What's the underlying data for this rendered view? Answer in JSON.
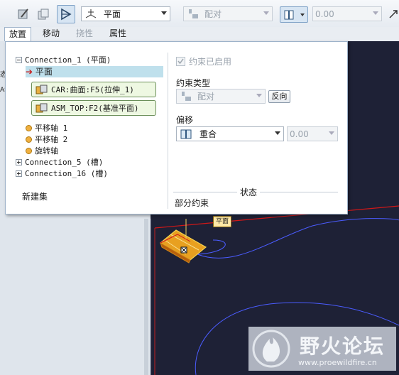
{
  "toolbar": {
    "constraint_type": "平面",
    "align_type": "配对",
    "offset_value": "0.00"
  },
  "tabs": [
    {
      "label": "放置"
    },
    {
      "label": "移动"
    },
    {
      "label": "挠性"
    },
    {
      "label": "属性"
    }
  ],
  "left_fragments": [
    "态",
    "ASM"
  ],
  "tree": {
    "root": "Connection_1 (平面)",
    "selected": "平面",
    "refs": [
      "CAR:曲面:F5(拉伸_1)",
      "ASM_TOP:F2(基准平面)"
    ],
    "items": [
      "平移轴 1",
      "平移轴 2",
      "旋转轴"
    ],
    "collapsed": [
      "Connection_5 (槽)",
      "Connection_16 (槽)"
    ],
    "new_set": "新建集"
  },
  "options": {
    "constraint_enabled": "约束已启用",
    "constraint_type_label": "约束类型",
    "constraint_type_value": "配对",
    "flip_button": "反向",
    "offset_label": "偏移",
    "offset_type": "重合",
    "offset_value": "0.00",
    "status_label": "状态",
    "status_value": "部分约束"
  },
  "viewport": {
    "plane_tag": "平面"
  },
  "watermark": {
    "name": "野火论坛",
    "url": "www.proewildfire.cn"
  }
}
